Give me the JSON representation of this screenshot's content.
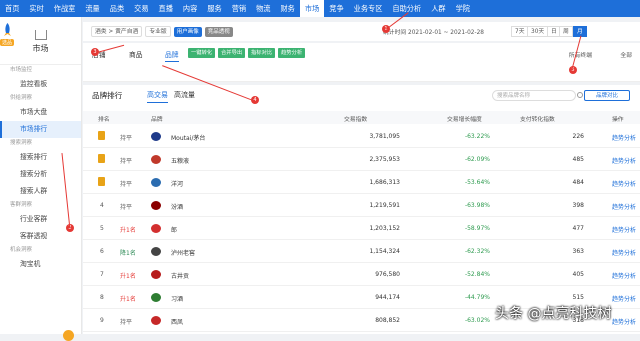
{
  "topnav": [
    "首页",
    "实时",
    "作战室",
    "流量",
    "品类",
    "交易",
    "直播",
    "内容",
    "服务",
    "营销",
    "物流",
    "财务",
    "市场",
    "竞争",
    "业务专区",
    "自助分析",
    "人群",
    "学院"
  ],
  "sidebar": {
    "title": "市场",
    "badge": "选品",
    "groups": [
      {
        "label": "市场监控",
        "items": [
          "监控看板"
        ]
      },
      {
        "label": "供给洞察",
        "items": [
          "市场大盘",
          "市场排行"
        ]
      },
      {
        "label": "搜索洞察",
        "items": [
          "搜索排行",
          "搜索分析",
          "搜索人群"
        ]
      },
      {
        "label": "客群洞察",
        "items": [
          "行业客群",
          "客群透视"
        ]
      },
      {
        "label": "机会洞察",
        "items": [
          "淘宝机"
        ]
      }
    ]
  },
  "filter": {
    "category": "酒类 > 黄产自酒",
    "type": "专业版",
    "btn1": "用户画像",
    "btn2": "竞品透视",
    "stat_label": "统计时间 2021-02-01 ~ 2021-02-28",
    "dates": [
      "7天",
      "30天",
      "日",
      "周",
      "月"
    ],
    "date_active": "月"
  },
  "subtabs": {
    "items": [
      "店铺",
      "商品",
      "品牌"
    ],
    "active": "品牌",
    "green": [
      "一键转化",
      "合并导出",
      "指标对比",
      "趋势分析"
    ],
    "right1": "所有终端",
    "right2": "全部"
  },
  "panel": {
    "title": "品牌排行",
    "tabs": [
      "高交易",
      "高流量"
    ],
    "search_placeholder": "搜索品牌名称",
    "btn": "品牌对比",
    "headers": [
      "排名",
      "品牌",
      "交易指数",
      "交易增长幅度",
      "支付转化指数",
      "操作"
    ],
    "rows": [
      {
        "rank": "1",
        "change": "持平",
        "brand": "Moutai/茅台",
        "trade": "3,781,095",
        "growth": "-63.22%",
        "conv": "226",
        "op": "趋势分析"
      },
      {
        "rank": "2",
        "change": "持平",
        "brand": "五粮液",
        "trade": "2,375,953",
        "growth": "-62.09%",
        "conv": "485",
        "op": "趋势分析"
      },
      {
        "rank": "3",
        "change": "持平",
        "brand": "洋河",
        "trade": "1,686,313",
        "growth": "-53.64%",
        "conv": "484",
        "op": "趋势分析"
      },
      {
        "rank": "4",
        "change": "持平",
        "brand": "汾酒",
        "trade": "1,219,591",
        "growth": "-63.98%",
        "conv": "398",
        "op": "趋势分析"
      },
      {
        "rank": "5",
        "change": "升1名",
        "brand": "郎",
        "trade": "1,203,152",
        "growth": "-58.97%",
        "conv": "477",
        "op": "趋势分析"
      },
      {
        "rank": "6",
        "change": "降1名",
        "brand": "泸州老窖",
        "trade": "1,154,324",
        "growth": "-62.32%",
        "conv": "363",
        "op": "趋势分析"
      },
      {
        "rank": "7",
        "change": "升1名",
        "brand": "古井贡",
        "trade": "976,580",
        "growth": "-52.84%",
        "conv": "405",
        "op": "趋势分析"
      },
      {
        "rank": "8",
        "change": "升1名",
        "brand": "习酒",
        "trade": "944,174",
        "growth": "-44.79%",
        "conv": "515",
        "op": "趋势分析"
      },
      {
        "rank": "9",
        "change": "持平",
        "brand": "西凤",
        "trade": "808,852",
        "growth": "-63.02%",
        "conv": "318",
        "op": "趋势分析"
      }
    ]
  },
  "annotations": [
    "1",
    "2",
    "3",
    "4",
    "5"
  ],
  "watermark": "头条 @点亮科技树",
  "colors": {
    "primary": "#1e6fd9",
    "up": "#e53935",
    "down": "#2e8b57",
    "annot": "#e53935"
  }
}
